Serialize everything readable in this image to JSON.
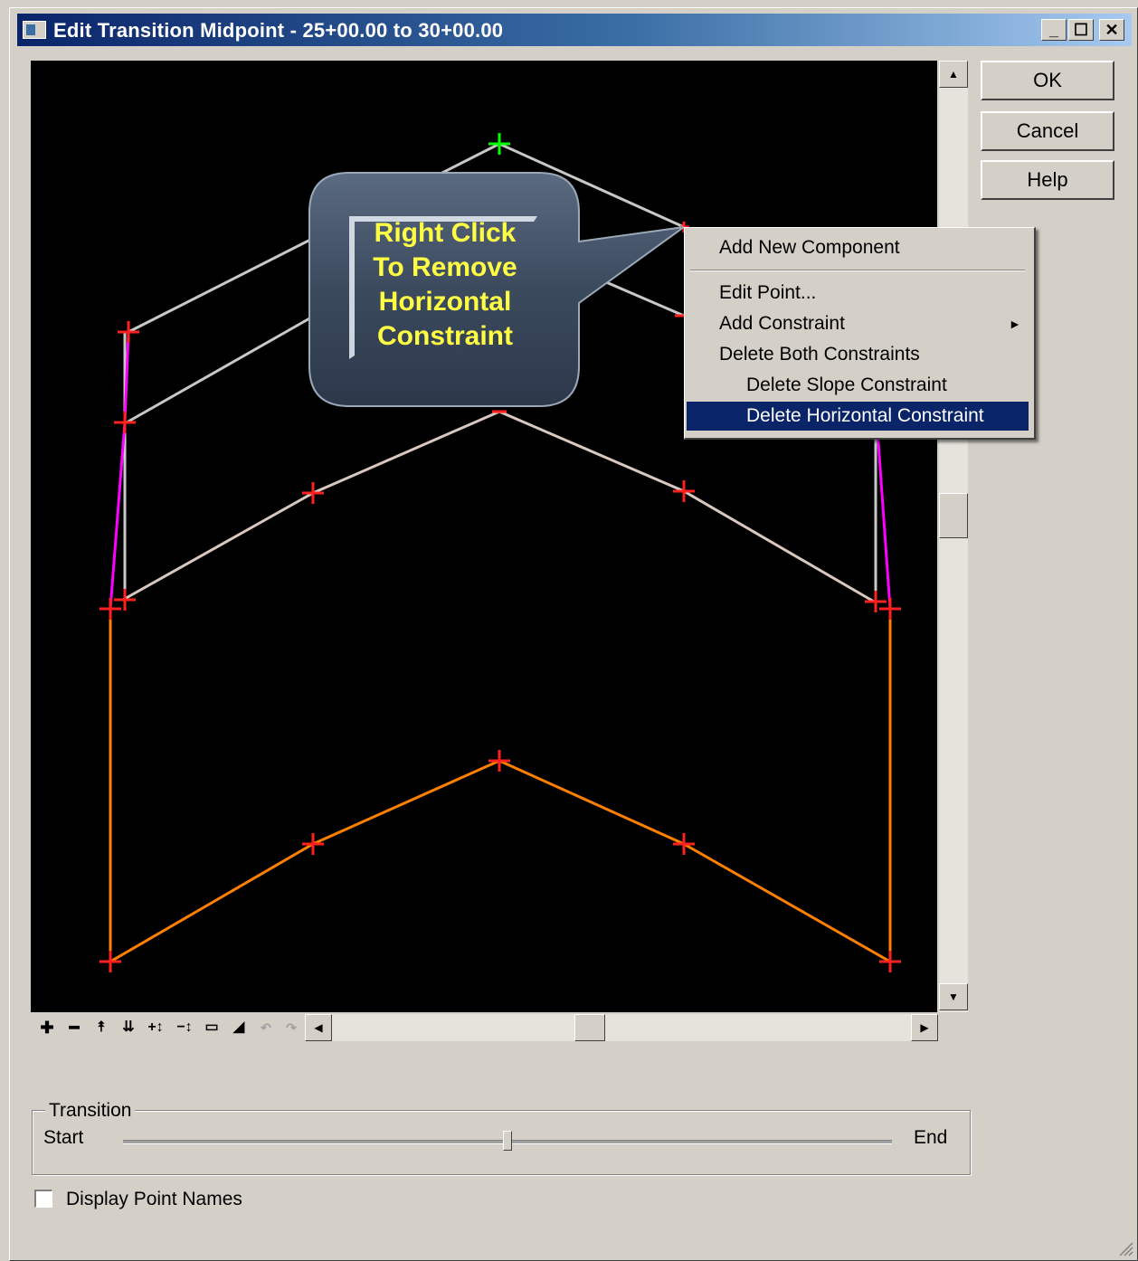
{
  "window": {
    "title": "Edit Transition Midpoint - 25+00.00 to 30+00.00",
    "controls": {
      "minimize": "_",
      "maximize": "☐",
      "close": "✕"
    }
  },
  "buttons": {
    "ok": "OK",
    "cancel": "Cancel",
    "help": "Help"
  },
  "callout": {
    "lines": [
      "Right Click",
      "To Remove",
      "Horizontal",
      "Constraint"
    ],
    "text_color": "#ffff44"
  },
  "context_menu": {
    "items": [
      {
        "label": "Add New Component"
      },
      {
        "label": "Edit Point..."
      },
      {
        "label": "Add Constraint",
        "submenu_arrow": "►"
      },
      {
        "label": "Delete Both Constraints"
      },
      {
        "label": "Delete Slope Constraint"
      },
      {
        "label": "Delete Horizontal Constraint",
        "selected": true
      }
    ]
  },
  "toolbar": {
    "icons": [
      "zoom-in-icon",
      "zoom-out-icon",
      "pan-icon",
      "fit-icon",
      "expand-icon",
      "shrink-icon",
      "window-icon",
      "terrain-icon",
      "undo-icon",
      "redo-icon"
    ]
  },
  "transition": {
    "group_label": "Transition",
    "start_label": "Start",
    "end_label": "End",
    "position_fraction": 0.5
  },
  "options": {
    "display_point_names": "Display Point Names",
    "display_point_names_checked": false
  },
  "colors": {
    "canvas": "#000000",
    "orange_component": "#ff8000",
    "magenta_component": "#ff00ff",
    "point_marker": "#ff2020",
    "origin_marker": "#00ff00",
    "selection": "#0a246a"
  }
}
